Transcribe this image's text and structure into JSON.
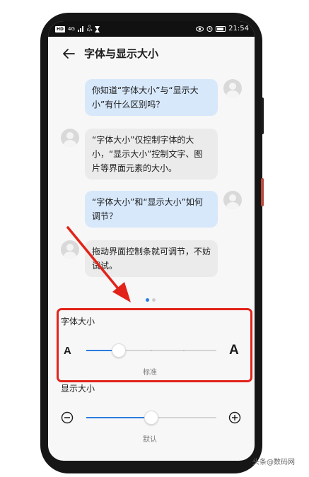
{
  "status_bar": {
    "badge": "HD",
    "signal": "4G",
    "speed_value": "0",
    "speed_unit": "K/s",
    "time": "21:54"
  },
  "header": {
    "title": "字体与显示大小"
  },
  "chat": [
    {
      "side": "right",
      "text": "你知道“字体大小”与“显示大小”有什么区别吗？"
    },
    {
      "side": "left",
      "text": "“字体大小”仅控制字体的大小，“显示大小”控制文字、图片等界面元素的大小。"
    },
    {
      "side": "right",
      "text": "“字体大小”和“显示大小”如何调节？"
    },
    {
      "side": "left",
      "text": "拖动界面控制条就可调节，不妨试试。"
    }
  ],
  "pager": {
    "count": 2,
    "active": 0
  },
  "font_size": {
    "label": "字体大小",
    "small_glyph": "A",
    "large_glyph": "A",
    "caption": "标准",
    "value_step": 1,
    "steps": 5
  },
  "display_size": {
    "label": "显示大小",
    "caption": "默认",
    "value_step": 1,
    "steps": 3
  },
  "watermark": {
    "text": "头条@数码网"
  },
  "colors": {
    "accent": "#2a7de1",
    "annotation": "#e2231a",
    "bubble_right": "#d7e8fb",
    "bubble_left": "#ebebeb"
  }
}
